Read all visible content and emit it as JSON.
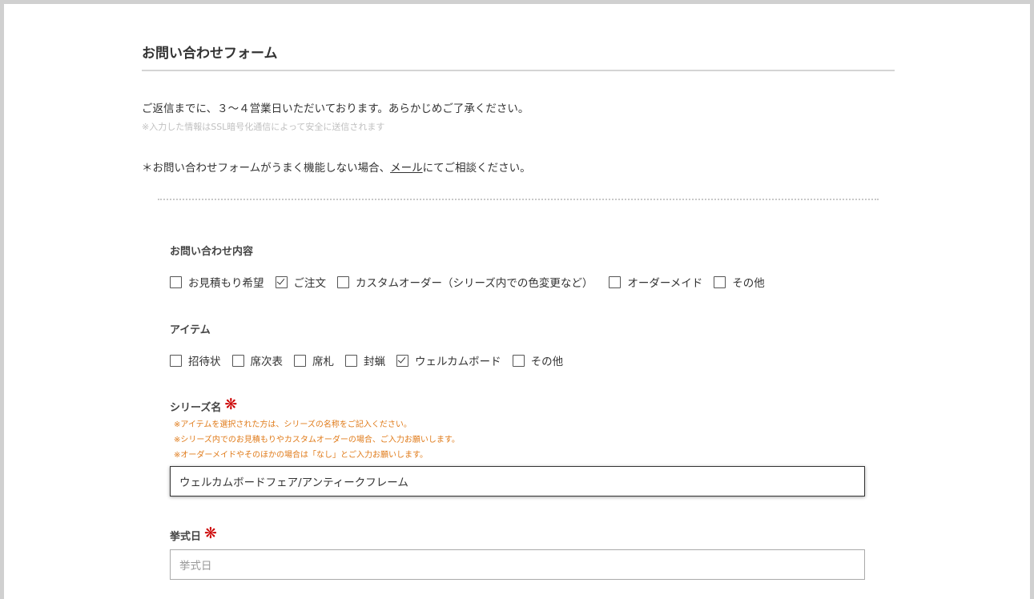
{
  "form": {
    "title": "お問い合わせフォーム",
    "intro": "ご返信までに、３～４営業日いただいております。あらかじめご了承ください。",
    "ssl_note": "※入力した情報はSSL暗号化通信によって安全に送信されます",
    "contact_prefix": "＊お問い合わせフォームがうまく機能しない場合、",
    "contact_link": "メール",
    "contact_suffix": "にてご相談ください。"
  },
  "inquiry": {
    "label": "お問い合わせ内容",
    "options": [
      {
        "label": "お見積もり希望",
        "checked": false
      },
      {
        "label": "ご注文",
        "checked": true
      },
      {
        "label": "カスタムオーダー（シリーズ内での色変更など）",
        "checked": false
      },
      {
        "label": "オーダーメイド",
        "checked": false
      },
      {
        "label": "その他",
        "checked": false
      }
    ]
  },
  "item": {
    "label": "アイテム",
    "options": [
      {
        "label": "招待状",
        "checked": false
      },
      {
        "label": "席次表",
        "checked": false
      },
      {
        "label": "席札",
        "checked": false
      },
      {
        "label": "封蝋",
        "checked": false
      },
      {
        "label": "ウェルカムボード",
        "checked": true
      },
      {
        "label": "その他",
        "checked": false
      }
    ]
  },
  "series": {
    "label": "シリーズ名",
    "required_mark": "❋",
    "notes": [
      "※アイテムを選択された方は、シリーズの名称をご記入ください。",
      "※シリーズ内でのお見積もりやカスタムオーダーの場合、ご入力お願いします。",
      "※オーダーメイドやそのほかの場合は「なし」とご入力お願いします。"
    ],
    "value": "ウェルカムボードフェア/アンティークフレーム"
  },
  "ceremony": {
    "label": "挙式日",
    "required_mark": "❋",
    "placeholder": "挙式日"
  }
}
